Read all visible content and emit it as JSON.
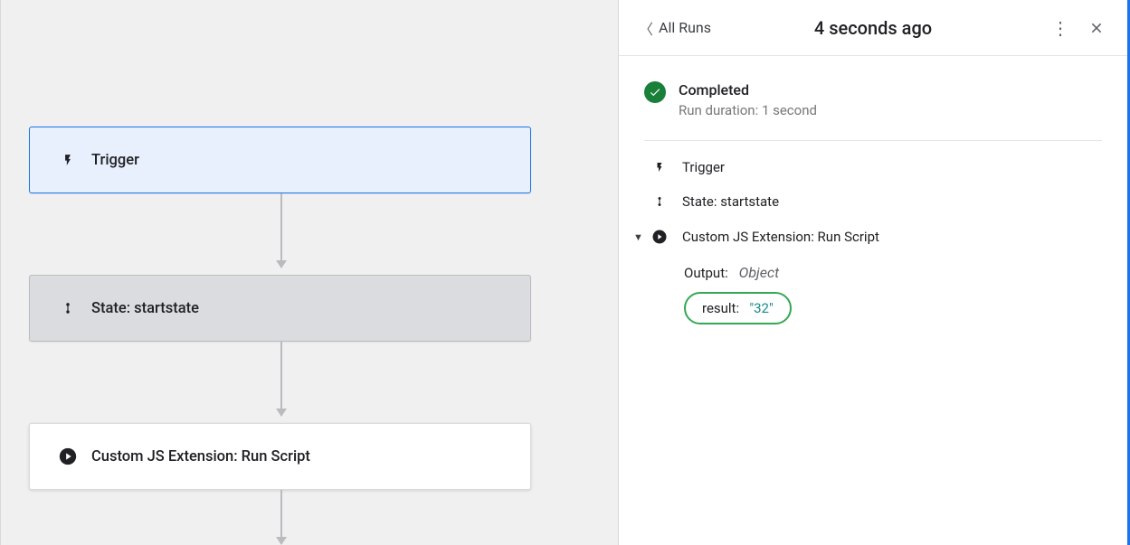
{
  "canvas": {
    "trigger_label": "Trigger",
    "state_label": "State: startstate",
    "script_label": "Custom JS Extension: Run Script"
  },
  "panel": {
    "back_label": "All Runs",
    "title": "4 seconds ago",
    "status": {
      "title": "Completed",
      "subtitle": "Run duration: 1 second"
    },
    "steps": {
      "trigger": "Trigger",
      "state": "State: startstate",
      "script": "Custom JS Extension: Run Script"
    },
    "output": {
      "label": "Output:",
      "type": "Object",
      "result_key": "result:",
      "result_value": "\"32\""
    }
  }
}
